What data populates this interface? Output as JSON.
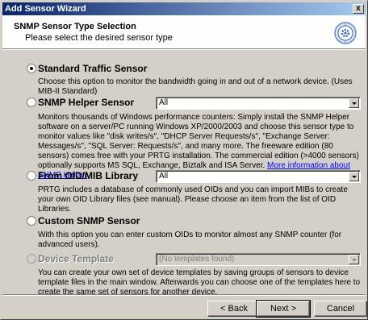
{
  "window": {
    "title": "Add Sensor Wizard",
    "close_glyph": "x"
  },
  "header": {
    "title": "SNMP Sensor Type Selection",
    "subtitle": "Please select the desired sensor type",
    "icon": "wizard-gear-icon"
  },
  "options": [
    {
      "label": "Standard Traffic Sensor",
      "selected": true,
      "description": "Choose this option to monitor the bandwidth going in and out of a network device. (Uses MIB-II Standard)"
    },
    {
      "label": "SNMP Helper Sensor",
      "selected": false,
      "combo_value": "All",
      "description": "Monitors thousands of Windows performance counters: Simply install the SNMP Helper software on a server/PC running Windows XP/2000/2003 and choose this sensor type to monitor values like \"disk writes/s\", \"DHCP Server Requests/s\", \"Exchange Server: Messages/s\", \"SQL Server: Requests/s\", and many more. The freeware edition (80 sensors) comes free with your PRTG installation. The commercial edition (>4000 sensors) optionally supports MS SQL, Exchange, Biztalk and ISA Server.",
      "link": "More information about SNMP Helper"
    },
    {
      "label": "From OID/MIB Library",
      "selected": false,
      "combo_value": "All",
      "description": "PRTG includes a database of commonly used OIDs and you can import MIBs to create your own OID Library files (see manual). Please choose an item from the list of OID Libraries."
    },
    {
      "label": "Custom SNMP Sensor",
      "selected": false,
      "description": "With this option you can enter custom OIDs to monitor almost any SNMP counter (for advanced users)."
    },
    {
      "label": "Device Template",
      "selected": false,
      "disabled": true,
      "combo_value": "(No templates found)",
      "description": "You can create your own set of device templates by saving groups of sensors to device template files in the main window. Afterwards you can choose one of the templates here to create the same set of sensors for another device."
    }
  ],
  "buttons": {
    "back": "< Back",
    "next": "Next >",
    "cancel": "Cancel"
  },
  "colors": {
    "title_bar": "#0a246a",
    "dialog_bg": "#d4d0c8",
    "link": "#0000ff"
  }
}
